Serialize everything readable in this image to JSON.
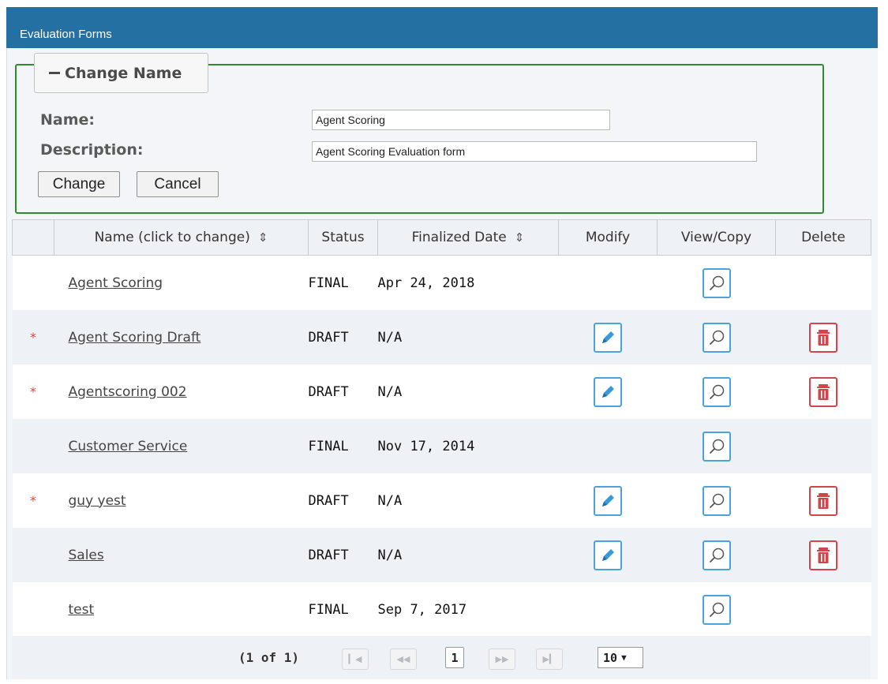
{
  "panel": {
    "title": "Evaluation Forms"
  },
  "change_name": {
    "legend": "Change Name",
    "name_label": "Name:",
    "name_value": "Agent Scoring",
    "description_label": "Description:",
    "description_value": "Agent Scoring Evaluation form",
    "change_button": "Change",
    "cancel_button": "Cancel"
  },
  "table": {
    "headers": {
      "name": "Name (click to change)",
      "status": "Status",
      "finalized": "Finalized Date",
      "modify": "Modify",
      "view": "View/Copy",
      "delete": "Delete"
    },
    "rows": [
      {
        "star": "",
        "name": "Agent Scoring",
        "status": "FINAL",
        "date": "Apr 24, 2018",
        "modify": false,
        "delete": false
      },
      {
        "star": "*",
        "name": "Agent Scoring Draft",
        "status": "DRAFT",
        "date": "N/A",
        "modify": true,
        "delete": true
      },
      {
        "star": "*",
        "name": "Agentscoring 002",
        "status": "DRAFT",
        "date": "N/A",
        "modify": true,
        "delete": true
      },
      {
        "star": "",
        "name": "Customer Service",
        "status": "FINAL",
        "date": "Nov 17, 2014",
        "modify": false,
        "delete": false
      },
      {
        "star": "*",
        "name": "guy yest",
        "status": "DRAFT",
        "date": "N/A",
        "modify": true,
        "delete": true
      },
      {
        "star": "",
        "name": "Sales",
        "status": "DRAFT",
        "date": "N/A",
        "modify": true,
        "delete": true
      },
      {
        "star": "",
        "name": "test",
        "status": "FINAL",
        "date": "Sep 7, 2017",
        "modify": false,
        "delete": false
      }
    ]
  },
  "pagination": {
    "summary": "(1 of 1)",
    "current_page": "1",
    "rows_per_page": "10"
  },
  "colors": {
    "header_bar": "#2470a3",
    "fieldset_border": "#2e8b2e",
    "edit_accent": "#4aa3df",
    "delete_accent": "#d0464b",
    "required_star": "#e3433b"
  }
}
